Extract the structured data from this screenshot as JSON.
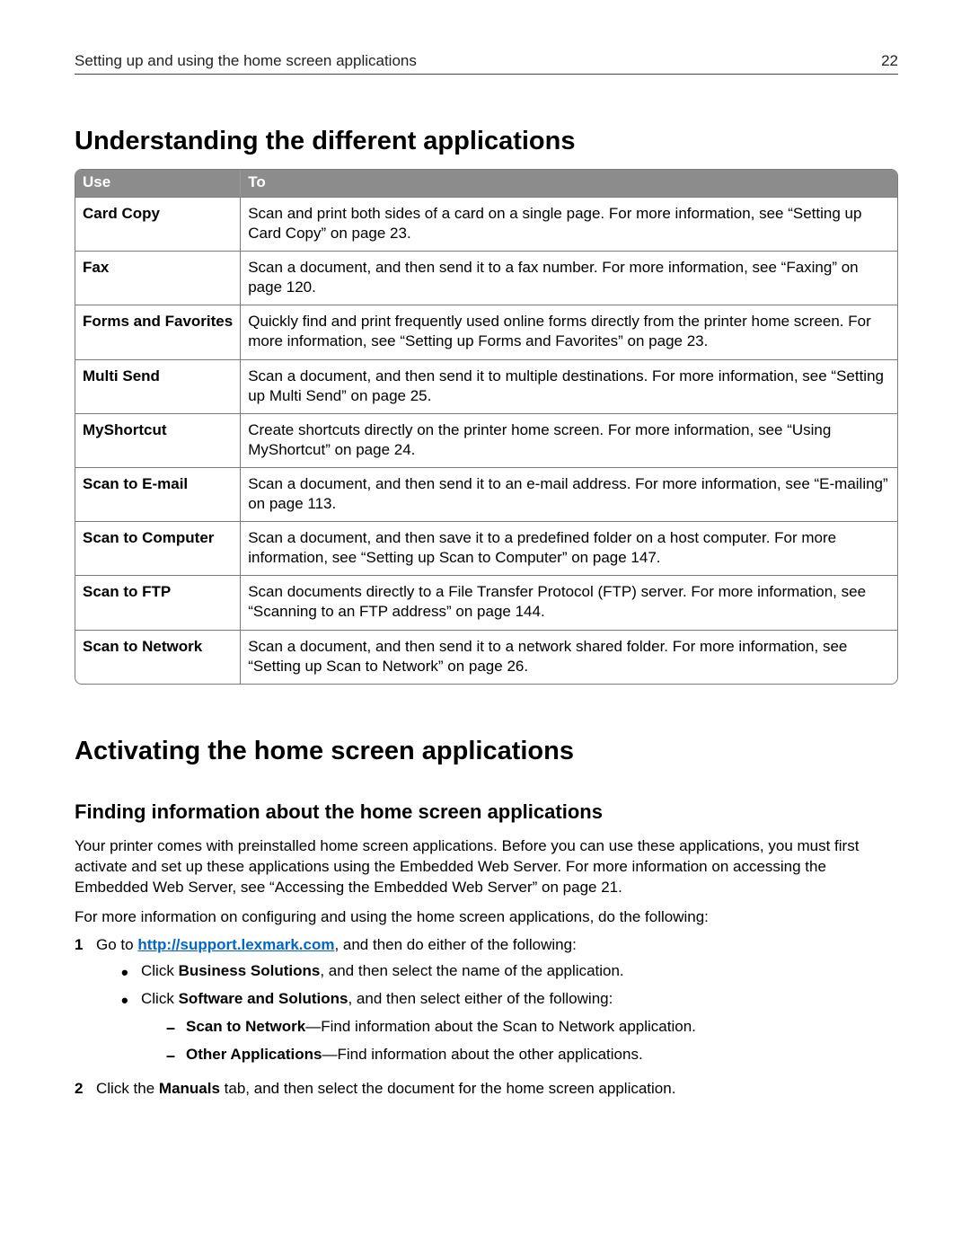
{
  "header": {
    "title": "Setting up and using the home screen applications",
    "page_number": "22"
  },
  "section1": {
    "heading": "Understanding the different applications",
    "table": {
      "col_use": "Use",
      "col_to": "To",
      "rows": [
        {
          "use": "Card Copy",
          "to": "Scan and print both sides of a card on a single page. For more information, see “Setting up Card Copy” on page 23."
        },
        {
          "use": "Fax",
          "to": "Scan a document, and then send it to a fax number. For more information, see “Faxing” on page 120."
        },
        {
          "use": "Forms and Favorites",
          "to": "Quickly find and print frequently used online forms directly from the printer home screen. For more information, see “Setting up Forms and Favorites” on page 23."
        },
        {
          "use": "Multi Send",
          "to": "Scan a document, and then send it to multiple destinations. For more information, see “Setting up Multi Send” on page 25."
        },
        {
          "use": "MyShortcut",
          "to": "Create shortcuts directly on the printer home screen. For more information, see “Using MyShortcut” on page 24."
        },
        {
          "use": "Scan to E-mail",
          "to": "Scan a document, and then send it to an e-mail address. For more information, see “E-mailing” on page 113."
        },
        {
          "use": "Scan to Computer",
          "to": "Scan a document, and then save it to a predefined folder on a host computer. For more information, see “Setting up Scan to Computer” on page 147."
        },
        {
          "use": "Scan to FTP",
          "to": "Scan documents directly to a File Transfer Protocol (FTP) server. For more information, see “Scanning to an FTP address” on page 144."
        },
        {
          "use": "Scan to Network",
          "to": "Scan a document, and then send it to a network shared folder. For more information, see “Setting up Scan to Network” on page 26."
        }
      ]
    }
  },
  "section2": {
    "heading": "Activating the home screen applications",
    "subheading": "Finding information about the home screen applications",
    "para1": "Your printer comes with preinstalled home screen applications. Before you can use these applications, you must first activate and set up these applications using the Embedded Web Server. For more information on accessing the Embedded Web Server, see “Accessing the Embedded Web Server” on page 21.",
    "para2": "For more information on configuring and using the home screen applications, do the following:",
    "step1_prefix": "Go to ",
    "step1_link": "http://support.lexmark.com",
    "step1_suffix": ", and then do either of the following:",
    "bullet1_prefix": "Click ",
    "bullet1_bold": "Business Solutions",
    "bullet1_suffix": ", and then select the name of the application.",
    "bullet2_prefix": "Click ",
    "bullet2_bold": "Software and Solutions",
    "bullet2_suffix": ", and then select either of the following:",
    "dash1_bold": "Scan to Network",
    "dash1_suffix": "—Find information about the Scan to Network application.",
    "dash2_bold": "Other Applications",
    "dash2_suffix": "—Find information about the other applications.",
    "step2_prefix": "Click the ",
    "step2_bold": "Manuals",
    "step2_suffix": " tab, and then select the document for the home screen application."
  }
}
